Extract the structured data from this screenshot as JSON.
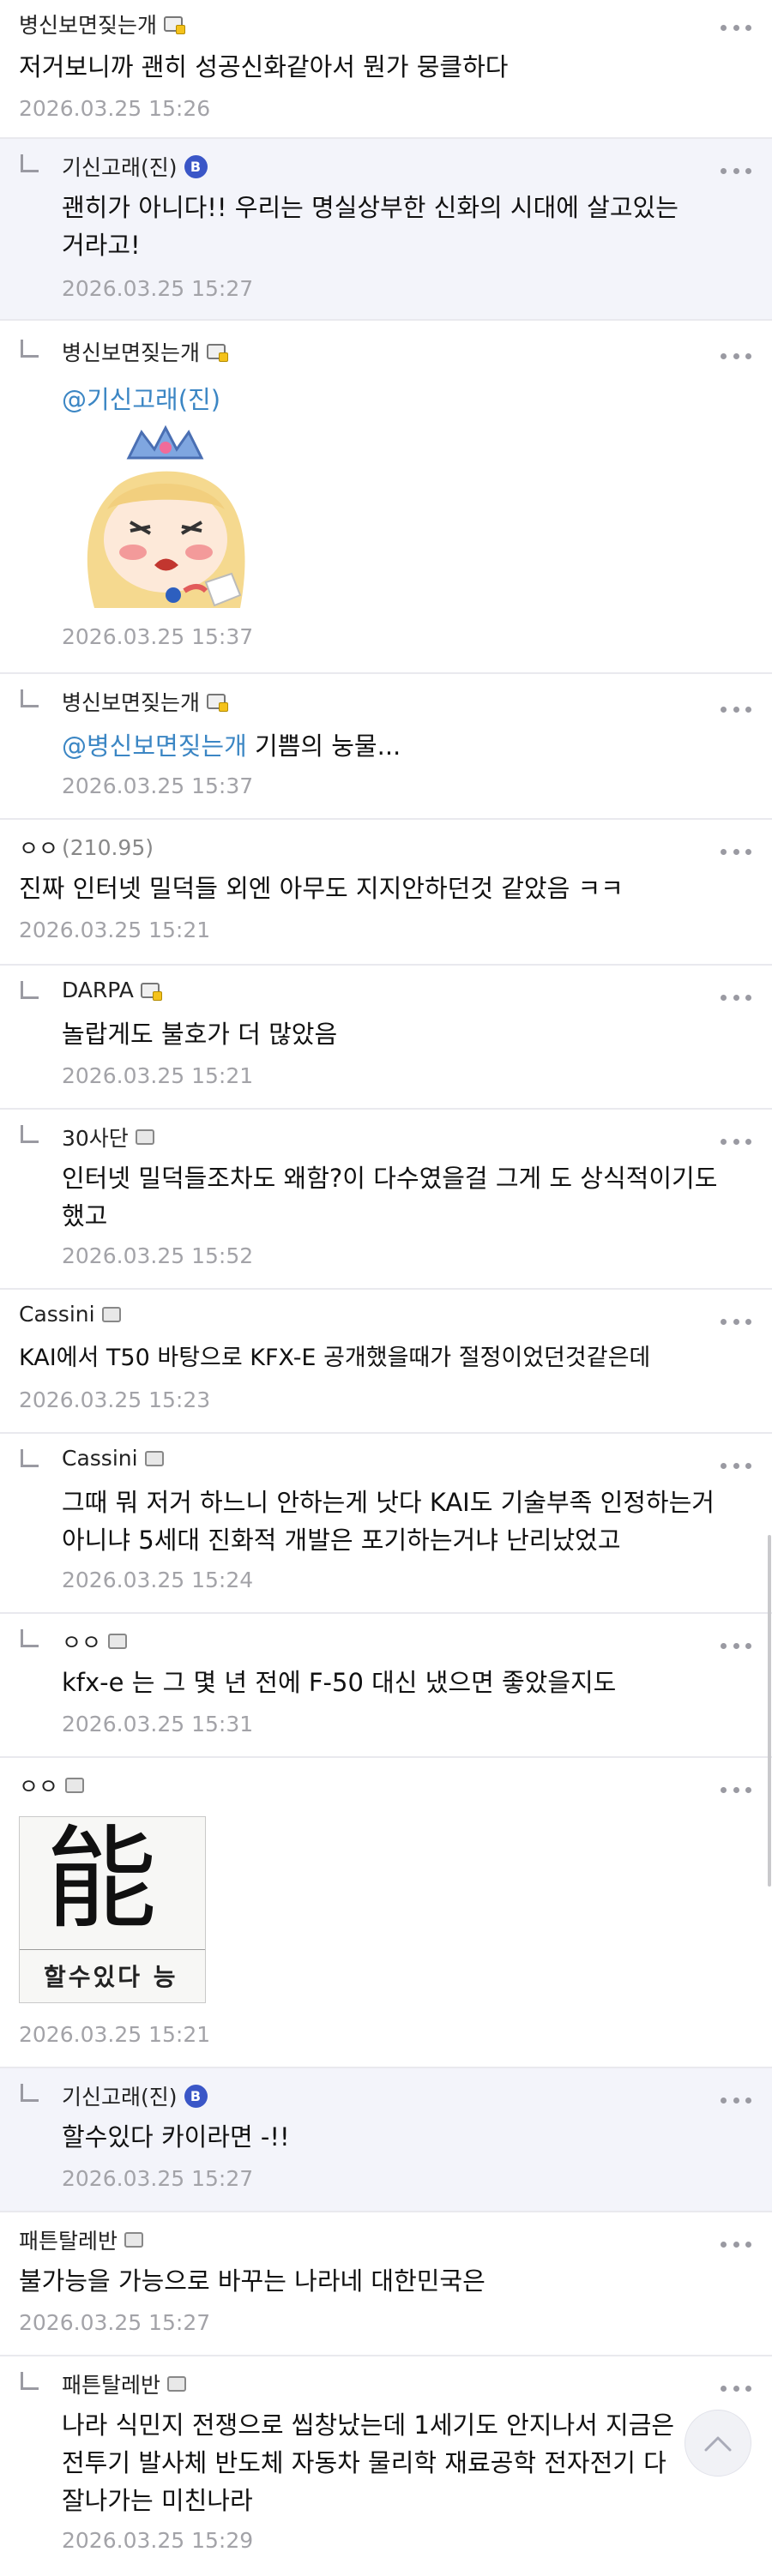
{
  "comments": [
    {
      "author": "병신보면짖는개",
      "ip": "",
      "badge": "fixed",
      "text": "저거보니까 괜히 성공신화같아서 뭔가 뭉클하다",
      "mention": "",
      "date": "2026.03.25 15:26",
      "reply": false
    },
    {
      "author": "기신고래(진)",
      "ip": "",
      "badge": "b",
      "text": "괜히가 아니다!! 우리는 명실상부한 신화의 시대에 살고있는\n거라고!",
      "mention": "",
      "date": "2026.03.25 15:27",
      "reply": true
    },
    {
      "author": "병신보면짖는개",
      "ip": "",
      "badge": "fixed",
      "text": "",
      "mention": "@기신고래(진)",
      "date": "2026.03.25 15:37",
      "reply": true
    },
    {
      "author": "병신보면짖는개",
      "ip": "",
      "badge": "fixed",
      "text": " 기쁨의 눙물...",
      "mention": "@병신보면짖는개",
      "date": "2026.03.25 15:37",
      "reply": true
    },
    {
      "author": "ㅇㅇ",
      "ip": "(210.95)",
      "badge": "",
      "text": "진짜 인터넷 밀덕들 외엔 아무도 지지안하던것 같았음 ㅋㅋ",
      "mention": "",
      "date": "2026.03.25 15:21",
      "reply": false
    },
    {
      "author": "DARPA",
      "ip": "",
      "badge": "fixed",
      "text": "놀랍게도 불호가 더 많았음",
      "mention": "",
      "date": "2026.03.25 15:21",
      "reply": true
    },
    {
      "author": "30사단",
      "ip": "",
      "badge": "half",
      "text": "인터넷 밀덕들조차도 왜함?이 다수였을걸 그게 도 상식적이기도\n했고",
      "mention": "",
      "date": "2026.03.25 15:52",
      "reply": true
    },
    {
      "author": "Cassini",
      "ip": "",
      "badge": "half",
      "text": "KAI에서 T50 바탕으로 KFX-E 공개했을때가 절정이었던것같은데",
      "mention": "",
      "date": "2026.03.25 15:23",
      "reply": false
    },
    {
      "author": "Cassini",
      "ip": "",
      "badge": "half",
      "text": "그때 뭐 저거 하느니 안하는게 낫다 KAI도 기술부족 인정하는거\n아니냐 5세대 진화적 개발은 포기하는거냐 난리났었고",
      "mention": "",
      "date": "2026.03.25 15:24",
      "reply": true
    },
    {
      "author": "ㅇㅇ",
      "ip": "",
      "badge": "half",
      "text": "kfx-e 는 그 몇 년 전에 F-50 대신 냈으면 좋았을지도",
      "mention": "",
      "date": "2026.03.25 15:31",
      "reply": true
    },
    {
      "author": "ㅇㅇ",
      "ip": "",
      "badge": "half",
      "text": "",
      "mention": "",
      "date": "2026.03.25 15:21",
      "reply": false
    },
    {
      "author": "기신고래(진)",
      "ip": "",
      "badge": "b",
      "text": "할수있다 카이라면 -!!",
      "mention": "",
      "date": "2026.03.25 15:27",
      "reply": true
    },
    {
      "author": "패튼탈레반",
      "ip": "",
      "badge": "half",
      "text": "불가능을 가능으로 바꾸는 나라네 대한민국은",
      "mention": "",
      "date": "2026.03.25 15:27",
      "reply": false
    },
    {
      "author": "패튼탈레반",
      "ip": "",
      "badge": "half",
      "text": "나라 식민지 전쟁으로 씹창났는데 1세기도 안지나서 지금은\n전투기 발사체 반도체 자동차 물리학 재료공학 전자전기 다\n잘나가는 미친나라",
      "mention": "",
      "date": "2026.03.25 15:29",
      "reply": true
    }
  ],
  "image_post": {
    "kanji": "能",
    "caption": "할수있다 능"
  },
  "icons": {
    "more": "more-dots-icon",
    "top": "scroll-to-top-icon",
    "badge_b": "B"
  },
  "colors": {
    "mention": "#3b86c4",
    "highlight_bg": "#f3f4fa",
    "date": "#a3a3a8"
  }
}
